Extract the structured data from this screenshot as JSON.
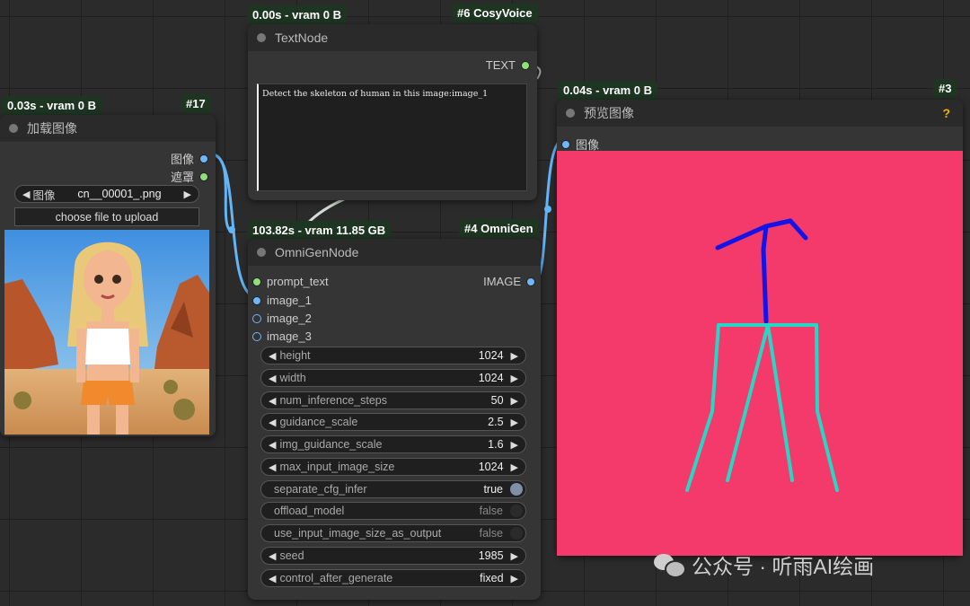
{
  "text_node": {
    "timing": "0.00s - vram 0 B",
    "id": "#6 CosyVoice",
    "title": "TextNode",
    "output_label": "TEXT",
    "text_value": "Detect the skeleton of human in this image:image_1"
  },
  "load_image_node": {
    "timing": "0.03s - vram 0 B",
    "id": "#17",
    "title": "加载图像",
    "outputs": [
      "图像",
      "遮罩"
    ],
    "image_widget_label": "图像",
    "image_widget_value": "cn__00001_.png",
    "upload_label": "choose file to upload"
  },
  "omnigen_node": {
    "timing": "103.82s - vram 11.85 GB",
    "id": "#4 OmniGen",
    "title": "OmniGenNode",
    "inputs": [
      "prompt_text",
      "image_1",
      "image_2",
      "image_3"
    ],
    "output_label": "IMAGE",
    "widgets": [
      {
        "label": "height",
        "value": "1024"
      },
      {
        "label": "width",
        "value": "1024"
      },
      {
        "label": "num_inference_steps",
        "value": "50"
      },
      {
        "label": "guidance_scale",
        "value": "2.5"
      },
      {
        "label": "img_guidance_scale",
        "value": "1.6"
      },
      {
        "label": "max_input_image_size",
        "value": "1024"
      }
    ],
    "toggles": [
      {
        "label": "separate_cfg_infer",
        "value": "true"
      },
      {
        "label": "offload_model",
        "value": "false"
      },
      {
        "label": "use_input_image_size_as_output",
        "value": "false"
      }
    ],
    "seed": {
      "label": "seed",
      "value": "1985"
    },
    "control": {
      "label": "control_after_generate",
      "value": "fixed"
    }
  },
  "preview_node": {
    "timing": "0.04s - vram 0 B",
    "id": "#3",
    "title": "预览图像",
    "help_icon": "?",
    "input_label": "图像",
    "background_color": "#f33a6a"
  },
  "watermark": {
    "text": "公众号 · 听雨AI绘画"
  },
  "colors": {
    "canvas": "#2b2b2b",
    "node_body": "#353535",
    "badge": "#1e3522",
    "link_blue": "#64b5f6",
    "link_white": "#d5dbd2"
  }
}
